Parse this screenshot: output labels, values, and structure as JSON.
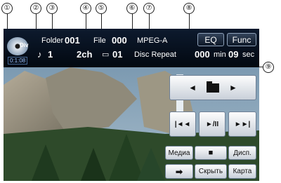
{
  "callouts": [
    "①",
    "②",
    "③",
    "④",
    "⑤",
    "⑥",
    "⑦",
    "⑧",
    "⑨"
  ],
  "source": {
    "disc_label": "Div",
    "time": "0:1:08"
  },
  "info": {
    "folder_label": "Folder",
    "folder_num": "001",
    "file_label": "File",
    "file_num": "000",
    "codec": "MPEG-A",
    "track_icon": "♪",
    "track_num": "1",
    "channels": "2ch",
    "subtitle_icon": "▭",
    "subtitle_num": "01",
    "repeat_mode": "Disc Repeat",
    "remaining_min": "000",
    "min_label": "min",
    "remaining_sec": "09",
    "sec_label": "sec"
  },
  "buttons": {
    "eq": "EQ",
    "func": "Func",
    "folder_prev": "◄",
    "folder_next": "►",
    "prev_track": "|◄◄",
    "play_pause": "►/II",
    "next_track": "►►|",
    "media": "Медиа",
    "stop": "■",
    "display": "Дисп.",
    "arrow": "➡",
    "hide": "Скрыть",
    "map": "Карта"
  },
  "colors": {
    "accent_text": "#ffffff",
    "topbar": "#0a1628"
  }
}
